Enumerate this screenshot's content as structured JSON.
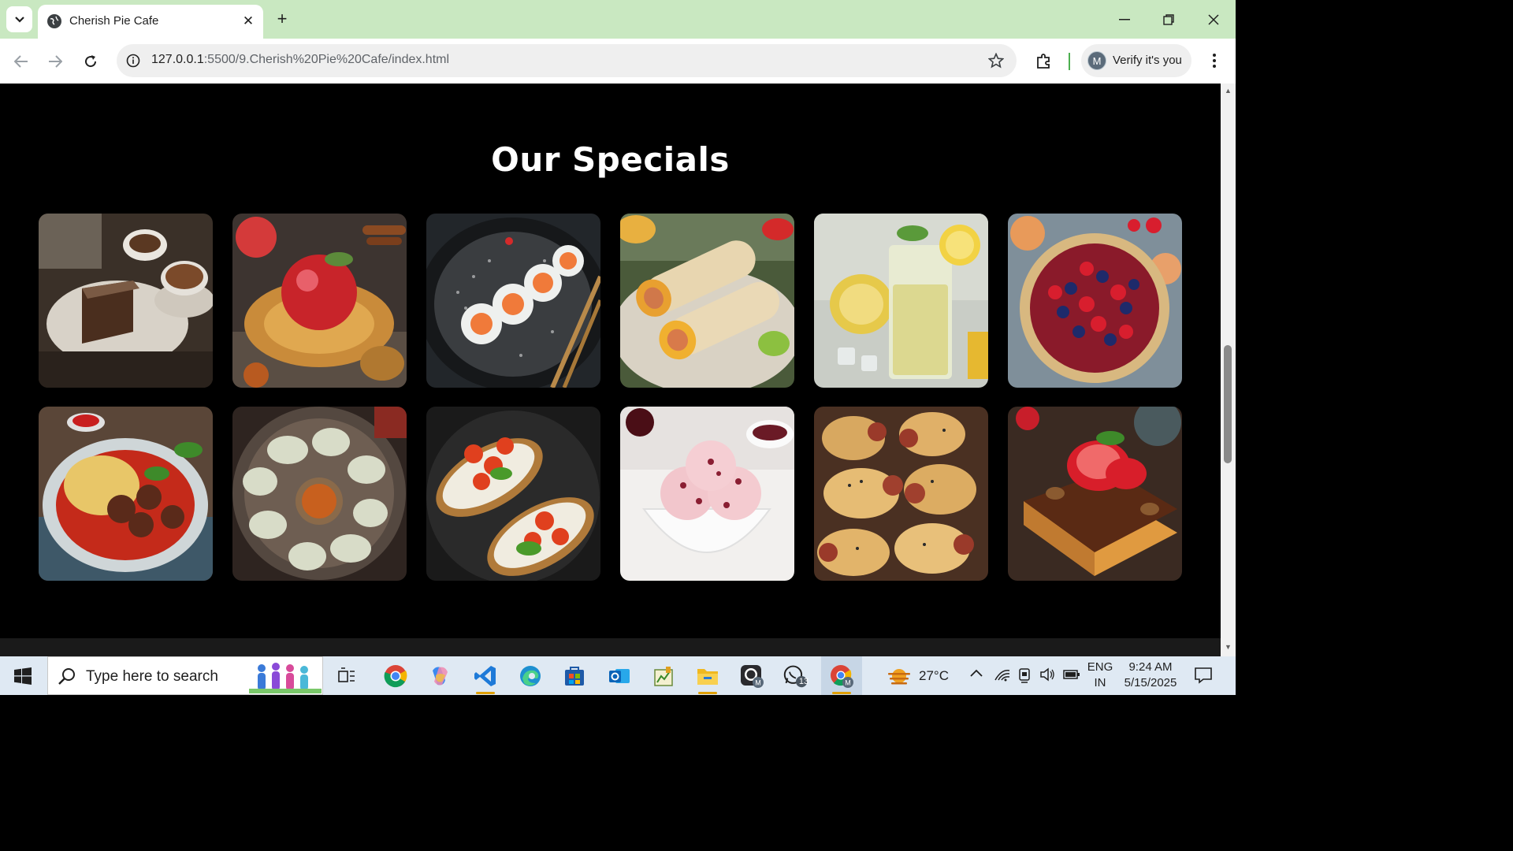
{
  "browser": {
    "tab_title": "Cherish Pie Cafe",
    "url_host": "127.0.0.1",
    "url_path": ":5500/9.Cherish%20Pie%20Cafe/index.html",
    "profile_label": "Verify it's you",
    "profile_initial": "M"
  },
  "page": {
    "title": "Our Specials",
    "specials": [
      {
        "icon": "coffee-cake-image"
      },
      {
        "icon": "apple-pastry-image"
      },
      {
        "icon": "sushi-rolls-image"
      },
      {
        "icon": "wraps-image"
      },
      {
        "icon": "lemonade-image"
      },
      {
        "icon": "berry-tart-image"
      },
      {
        "icon": "spaghetti-meatballs-image"
      },
      {
        "icon": "dumplings-image"
      },
      {
        "icon": "bruschetta-image"
      },
      {
        "icon": "ice-cream-image"
      },
      {
        "icon": "pigs-in-blanket-image"
      },
      {
        "icon": "strawberry-chocolate-toast-image"
      }
    ]
  },
  "taskbar": {
    "search_placeholder": "Type here to search",
    "weather_temp": "27°C",
    "language_line1": "ENG",
    "language_line2": "IN",
    "time": "9:24 AM",
    "date": "5/15/2025",
    "whatsapp_badge": "13"
  }
}
